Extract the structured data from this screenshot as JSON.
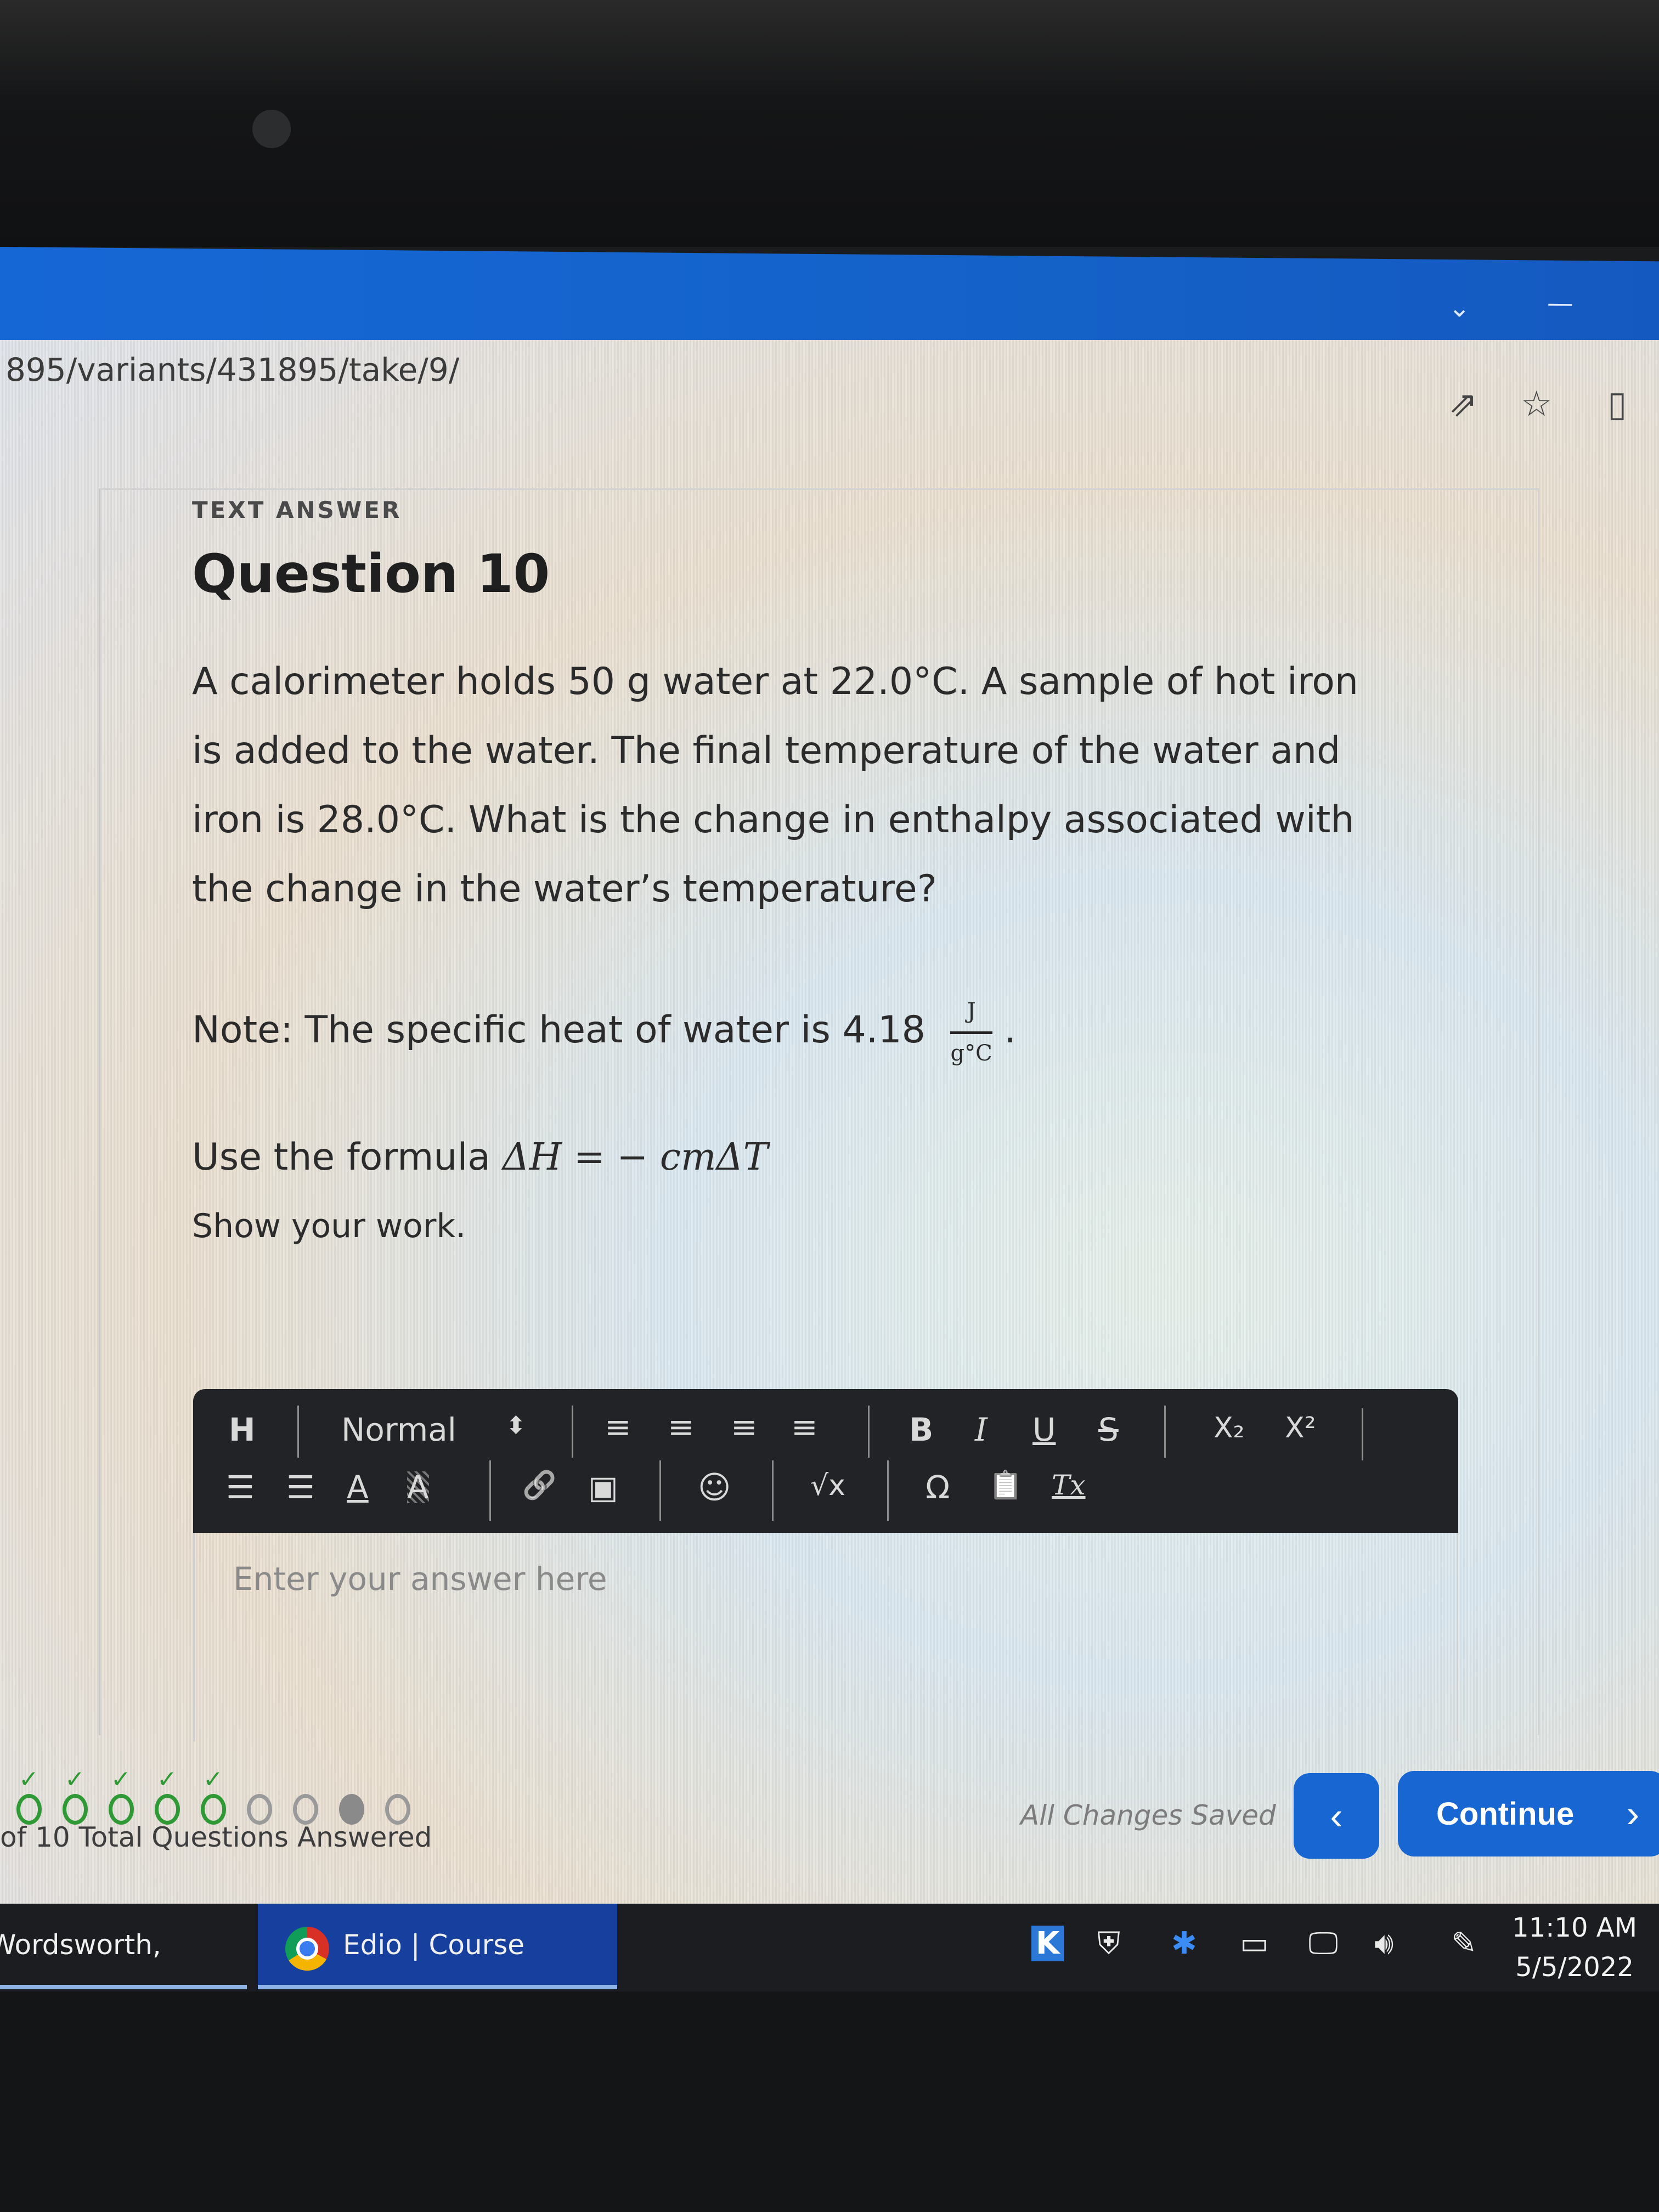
{
  "browser": {
    "url_fragment": "895/variants/431895/take/9/",
    "titlebar_icons": [
      "chevron-down-icon",
      "minimize-icon"
    ],
    "address_icons": [
      "share-icon",
      "star-icon",
      "reading-pane-icon"
    ]
  },
  "question": {
    "type_label": "TEXT ANSWER",
    "title": "Question 10",
    "body": "A calorimeter holds 50 g water at 22.0°C. A sample of hot iron is added to the water. The final temperature of the water and iron is 28.0°C. What is the change in enthalpy associated with the change in the water’s temperature?",
    "note_prefix": "Note: The specific heat of water is 4.18",
    "note_unit_numerator": "J",
    "note_unit_denominator": "g°C",
    "note_suffix": ".",
    "formula_prefix": "Use the formula",
    "formula": "ΔH = − cmΔT",
    "instruction": "Show your work."
  },
  "toolbar": {
    "heading": "H",
    "style_select": "Normal",
    "style_select_arrow": "⬍",
    "align_left": "≡",
    "align_center": "≡",
    "align_right": "≡",
    "align_justify": "≡",
    "bold": "B",
    "italic": "I",
    "underline": "U",
    "strike": "S",
    "subscript": "X₂",
    "superscript": "X²",
    "ordered_list": "☰",
    "bullet_list": "☰",
    "font_color": "A",
    "highlight": "A",
    "link": "🔗",
    "image": "▣",
    "emoji": "☺",
    "formula": "√x",
    "special_char": "Ω",
    "paste": "📋",
    "clear_format": "Tx"
  },
  "editor": {
    "placeholder": "Enter your answer here",
    "value": ""
  },
  "progress": {
    "total": 10,
    "answered_count_visible_text": "of 10 Total Questions Answered",
    "states": [
      "answered",
      "answered",
      "answered",
      "answered",
      "answered",
      "unanswered",
      "unanswered",
      "current",
      "unanswered"
    ]
  },
  "footer": {
    "save_status": "All Changes Saved",
    "prev_label": "‹",
    "continue_label": "Continue",
    "continue_chevron": "›"
  },
  "taskbar": {
    "tasks": [
      {
        "label": "Wordsworth, Shelle...",
        "active": false
      },
      {
        "label": "Edio | Course Stude...",
        "active": true
      }
    ],
    "tray_icons": [
      "k-app-icon",
      "security-shield-warning-icon",
      "bluetooth-icon",
      "battery-warning-icon",
      "network-icon",
      "volume-icon",
      "pen-icon"
    ],
    "time": "11:10 AM",
    "date": "5/5/2022"
  },
  "colors": {
    "accent": "#1766d1",
    "success": "#2f9a35",
    "toolbar_bg": "#222326",
    "taskbar_bg": "#1c1d20"
  }
}
